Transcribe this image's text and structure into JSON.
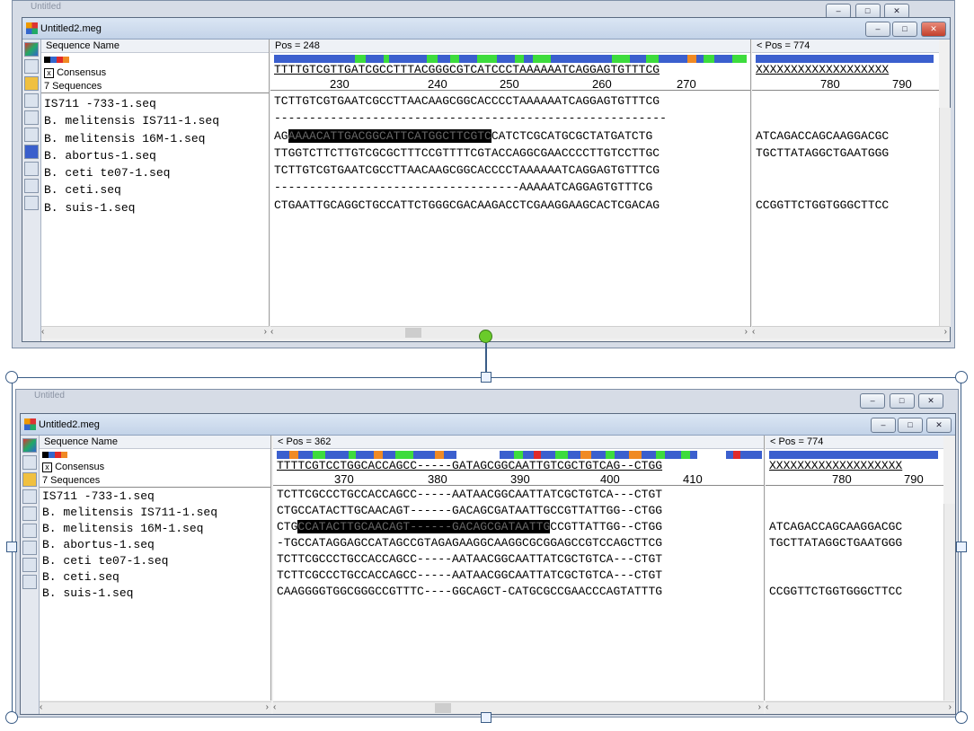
{
  "top": {
    "outer_title": "Untitled",
    "title": "Untitled2.meg",
    "name_header": "Sequence Name",
    "pos_left": "Pos = 248",
    "pos_right": "< Pos = 774",
    "consensus_label": "Consensus",
    "sequences_label": "7 Sequences",
    "consensus_seq": "TTTTGTCGTTGATCGCCTTTACGGGCGTCATCCCTAAAAAATCAGGAGTGTTTCG",
    "right_consensus": "XXXXXXXXXXXXXXXXXXX",
    "ruler": [
      "230",
      "240",
      "250",
      "260",
      "270"
    ],
    "right_ruler": [
      "780",
      "790"
    ],
    "names": [
      "IS711 -733-1.seq",
      "B. melitensis IS711-1.seq",
      "B. melitensis 16M-1.seq",
      "B. abortus-1.seq",
      "B. ceti te07-1.seq",
      "B. ceti.seq",
      "B. suis-1.seq"
    ],
    "seqs": [
      "TCTTGTCGTGAATCGCCTTAACAAGCGGCACCCCTAAAAAATCAGGAGTGTTTCG",
      "--------------------------------------------------------",
      "AG",
      "TTGGTCTTCTTGTCGCGCTTTCCGTTTTCGTACCAGGCGAACCCCTTGTCCTTGC",
      "TCTTGTCGTGAATCGCCTTAACAAGCGGCACCCCTAAAAAATCAGGAGTGTTTCG",
      "-----------------------------------AAAAATCAGGAGTGTTTCG",
      "CTGAATTGCAGGCTGCCATTCTGGGCGACAAGACCTCGAAGGAAGCACTCGACAG"
    ],
    "seq3_highlight": "AAAACATTGACGGCATTCATGGCTTCGTC",
    "seq3_tail": "CATCTCGCATGCGCTATGATCTG",
    "right_seqs": [
      "",
      "",
      "ATCAGACCAGCAAGGACGC",
      "TGCTTATAGGCTGAATGGG",
      "",
      "",
      "CCGGTTCTGGTGGGCTTCC"
    ]
  },
  "bottom": {
    "outer_title": "Untitled",
    "title": "Untitled2.meg",
    "name_header": "Sequence Name",
    "pos_left": "< Pos = 362",
    "pos_right": "< Pos = 774",
    "consensus_label": "Consensus",
    "sequences_label": "7 Sequences",
    "consensus_seq": "TTTTCGTCCTGGCACCAGCC-----GATAGCGGCAATTGTCGCTGTCAG--CTGG",
    "right_consensus": "XXXXXXXXXXXXXXXXXXX",
    "ruler": [
      "370",
      "380",
      "390",
      "400",
      "410"
    ],
    "right_ruler": [
      "780",
      "790"
    ],
    "names": [
      "IS711 -733-1.seq",
      "B. melitensis IS711-1.seq",
      "B. melitensis 16M-1.seq",
      "B. abortus-1.seq",
      "B. ceti te07-1.seq",
      "B. ceti.seq",
      "B. suis-1.seq"
    ],
    "seqs": [
      "TCTTCGCCCTGCCACCAGCC-----AATAACGGCAATTATCGCTGTCA---CTGT",
      "CTGCCATACTTGCAACAGT------GACAGCGATAATTGCCGTTATTGG--CTGG",
      "CTG",
      "-TGCCATAGGAGCCATAGCCGTAGAGAAGGCAAGGCGCGGAGCCGTCCAGCTTCG",
      "TCTTCGCCCTGCCACCAGCC-----AATAACGGCAATTATCGCTGTCA---CTGT",
      "TCTTCGCCCTGCCACCAGCC-----AATAACGGCAATTATCGCTGTCA---CTGT",
      "CAAGGGGTGGCGGGCCGTTTC----GGCAGCT-CATGCGCCGAACCCAGTATTTG"
    ],
    "seq3_highlight": "CCATACTTGCAACAGT------GACAGCGATAATTG",
    "seq3_tail": "CCGTTATTGG--CTGG",
    "right_seqs": [
      "",
      "",
      "ATCAGACCAGCAAGGACGC",
      "TGCTTATAGGCTGAATGGG",
      "",
      "",
      "CCGGTTCTGGTGGGCTTCC"
    ]
  },
  "controls": {
    "min": "–",
    "max": "□",
    "close": "✕"
  },
  "colors": {
    "blue": "#3b5fce",
    "green": "#3ddc3d",
    "orange": "#f08a24",
    "red": "#e02a2a"
  }
}
